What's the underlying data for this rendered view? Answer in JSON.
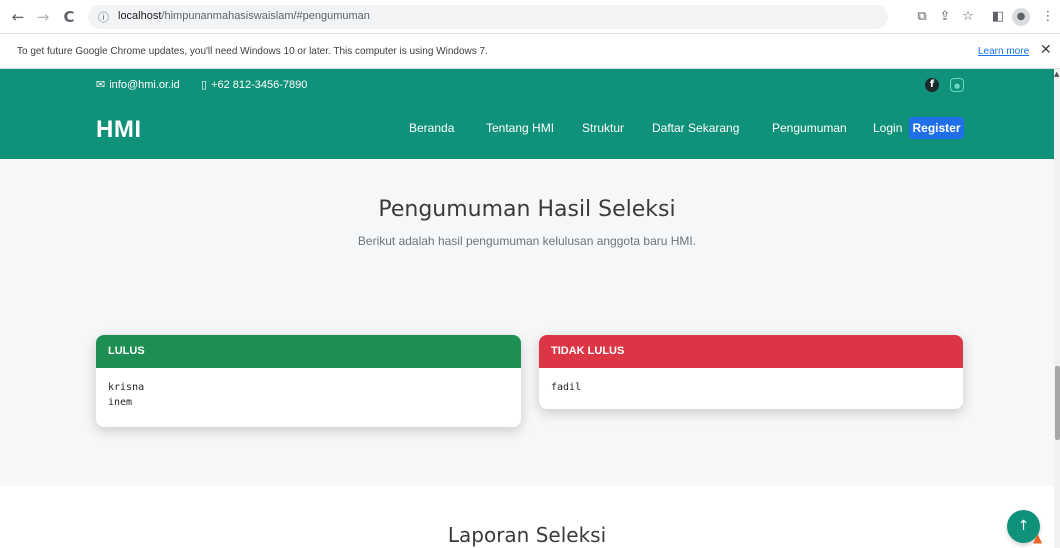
{
  "browser": {
    "back": "←",
    "forward": "→",
    "reload": "C",
    "info_icon": "ⓘ",
    "url_host": "localhost",
    "url_path": "/himpunanmahasiswaislam/#pengumuman",
    "icons": [
      "translate-icon",
      "share-icon",
      "star-icon",
      "sidepanel-icon",
      "profile-icon",
      "menu-icon"
    ]
  },
  "infobar": {
    "message": "To get future Google Chrome updates, you'll need Windows 10 or later. This computer is using Windows 7.",
    "learn_more": "Learn more",
    "close": "✕"
  },
  "topbar": {
    "email": "info@hmi.or.id",
    "phone": "+62 812-3456-7890"
  },
  "header": {
    "logo": "HMI",
    "nav": [
      "Beranda",
      "Tentang HMI",
      "Struktur",
      "Daftar Sekarang",
      "Pengumuman",
      "Login"
    ],
    "register": "Register"
  },
  "section": {
    "title": "Pengumuman Hasil Seleksi",
    "subtitle": "Berikut adalah hasil pengumuman kelulusan anggota baru HMI."
  },
  "cards": {
    "pass": {
      "title": "LULUS",
      "names": [
        "krisna",
        "inem"
      ]
    },
    "fail": {
      "title": "TIDAK LULUS",
      "names": [
        "fadil"
      ]
    }
  },
  "section2": {
    "title": "Laporan Seleksi"
  },
  "colors": {
    "brand": "#10917a",
    "pass": "#1e8f52",
    "fail": "#dc3545",
    "register": "#1f6fe8"
  }
}
